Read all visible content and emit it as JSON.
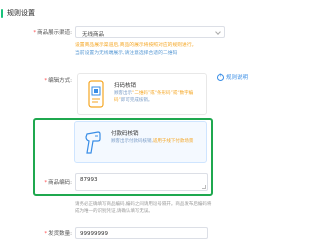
{
  "section": {
    "title": "规则设置"
  },
  "display_type": {
    "label": "商品展示渠道:",
    "value": "无线商品"
  },
  "hints": {
    "line1": "设置商品展示渠道后,商品的展示将按照对应的规则进行。",
    "line2": "当前设置为无线端展示,请注意选择合适的二维码"
  },
  "match": {
    "label": "编辑方式:",
    "help": "规则说明",
    "options": [
      {
        "title": "扫码核销",
        "desc_prefix": "顾客出示",
        "desc_warn": "“二维码”或“条形码”或“数字编码”",
        "desc_suffix": "即可完成核销。"
      },
      {
        "title": "付款码核销",
        "desc_prefix": "顾客出示付款码核销,",
        "desc_warn": "适用于线下付款场景"
      }
    ]
  },
  "code": {
    "label": "商品编码:",
    "value": "87993",
    "tip": "请务必正确填写商品编码,编码之间请用逗号隔开。商品发布后编码将成为唯一的识别凭证,请确认填写无误。"
  },
  "stock": {
    "label": "发货数量:",
    "value": "99999999"
  },
  "colors": {
    "accent_green": "#19c27b",
    "highlight_green": "#1fa84f",
    "warn_orange": "#f5a623",
    "link_blue": "#3a8ee6",
    "required_red": "#ff4d4f"
  }
}
